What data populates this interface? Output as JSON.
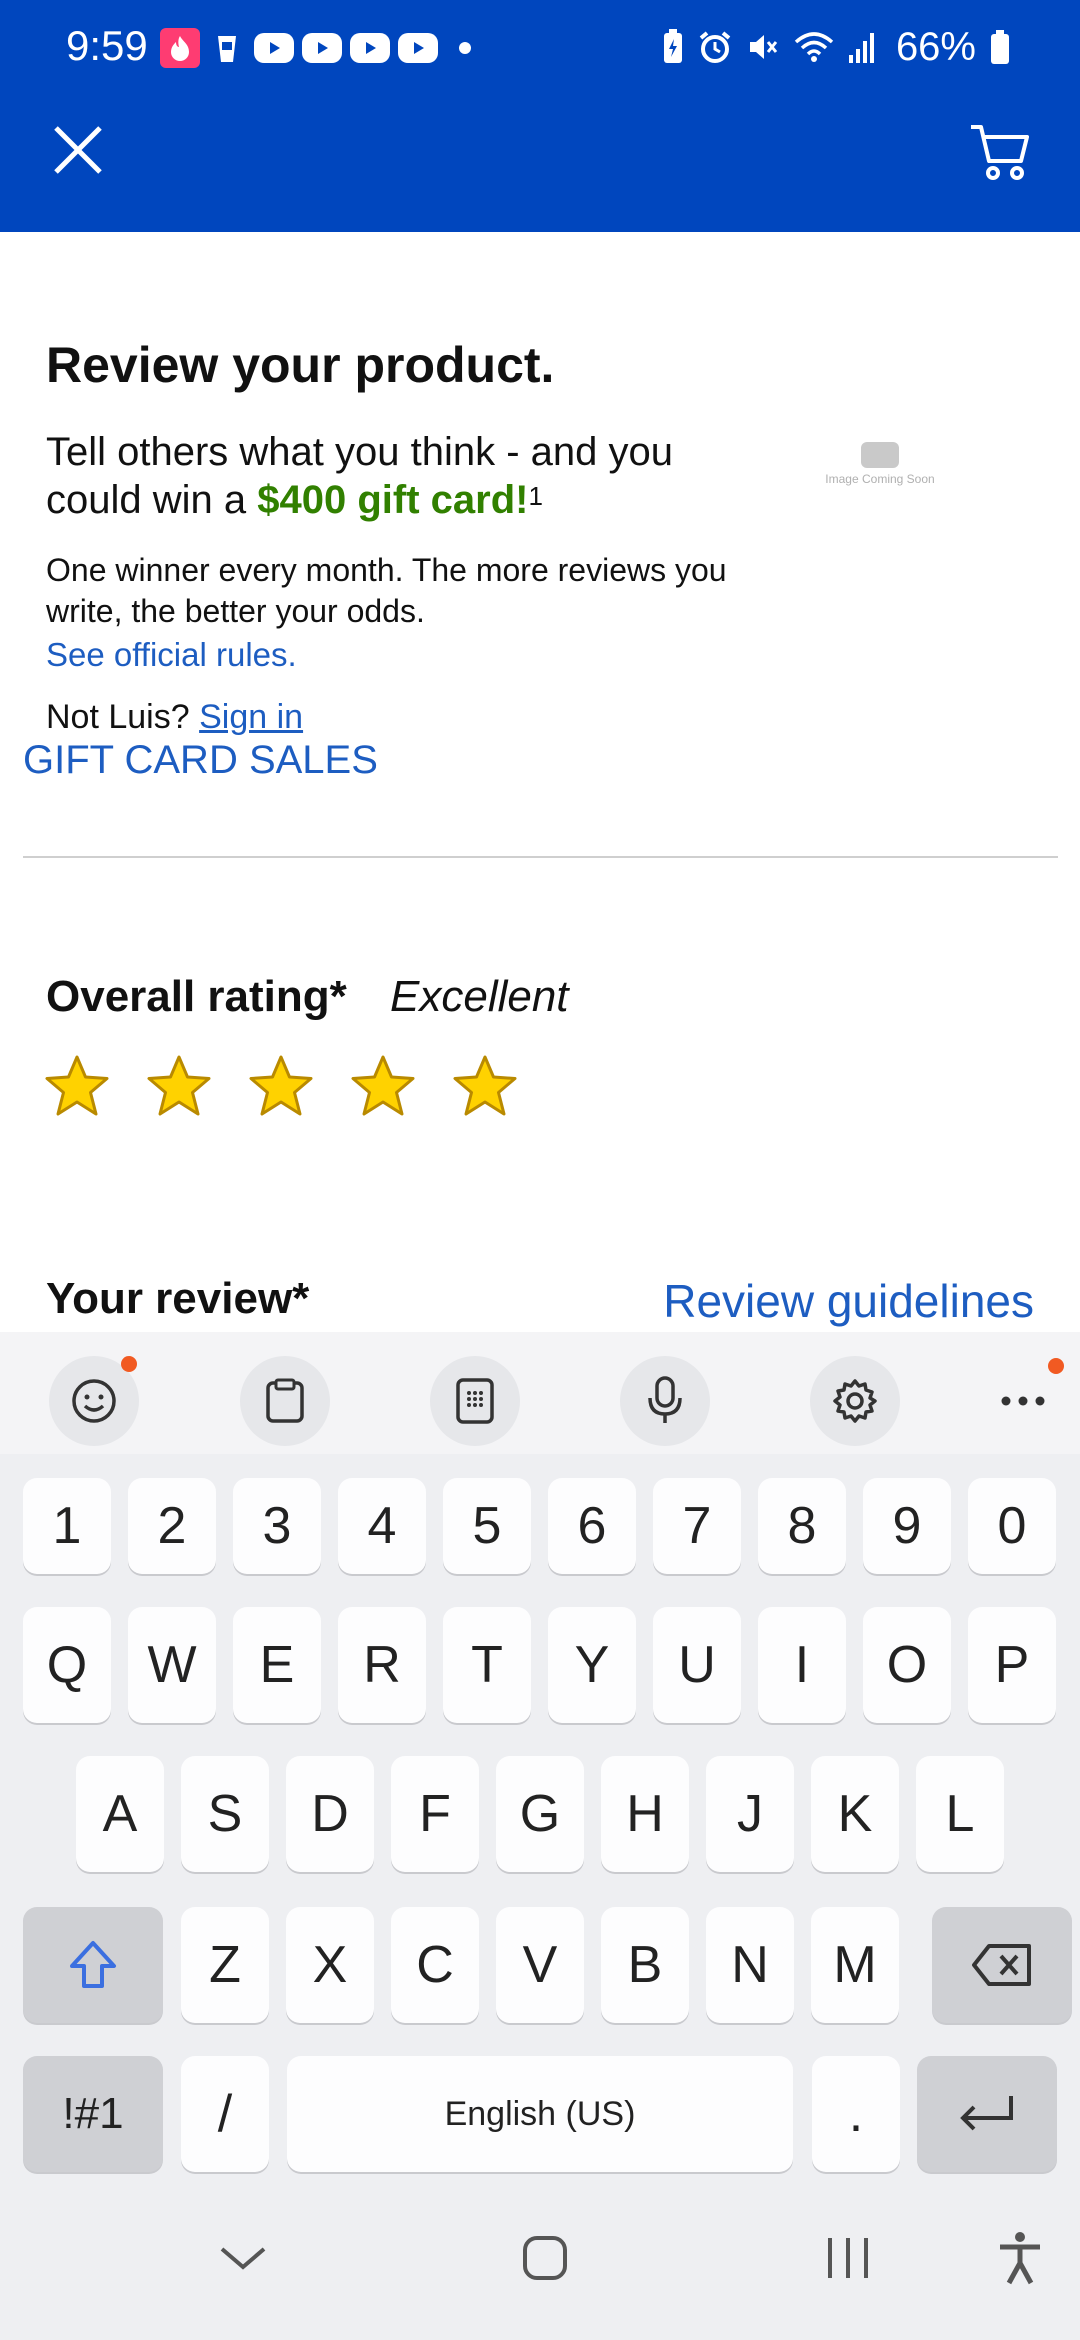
{
  "status_bar": {
    "time": "9:59",
    "battery_percent": "66%"
  },
  "header": {
    "close_icon": "close-icon",
    "cart_icon": "cart-icon",
    "accent_color": "#0046BE"
  },
  "intro": {
    "title": "Review your product.",
    "lead_prefix": "Tell others what you think - and you could win a ",
    "lead_highlight": "$400 gift card!",
    "lead_footnote": "1",
    "subtext": "One winner every month. The more reviews you write, the better your odds.",
    "rules_link": "See official rules.",
    "product_image_text": "Image Coming Soon",
    "not_user_prefix": "Not Luis?",
    "sign_in_link": "Sign in",
    "gift_card_sales": "GIFT CARD SALES"
  },
  "rating": {
    "label": "Overall rating*",
    "value_text": "Excellent",
    "stars_filled": 5,
    "stars_total": 5,
    "star_color": "#FFD200"
  },
  "review": {
    "label": "Your review*",
    "guidelines_link": "Review guidelines"
  },
  "keyboard": {
    "toolbar": [
      "emoji-icon",
      "clipboard-icon",
      "keypad-icon",
      "mic-icon",
      "settings-icon",
      "more-icon"
    ],
    "number_row": [
      "1",
      "2",
      "3",
      "4",
      "5",
      "6",
      "7",
      "8",
      "9",
      "0"
    ],
    "row1": [
      "Q",
      "W",
      "E",
      "R",
      "T",
      "Y",
      "U",
      "I",
      "O",
      "P"
    ],
    "row2": [
      "A",
      "S",
      "D",
      "F",
      "G",
      "H",
      "J",
      "K",
      "L"
    ],
    "row3": [
      "Z",
      "X",
      "C",
      "V",
      "B",
      "N",
      "M"
    ],
    "symbols_key": "!#1",
    "slash_key": "/",
    "space_label": "English (US)",
    "period_key": "."
  },
  "nav_bar": {
    "buttons": [
      "back-chevron-icon",
      "home-icon",
      "recents-icon",
      "accessibility-icon"
    ]
  }
}
